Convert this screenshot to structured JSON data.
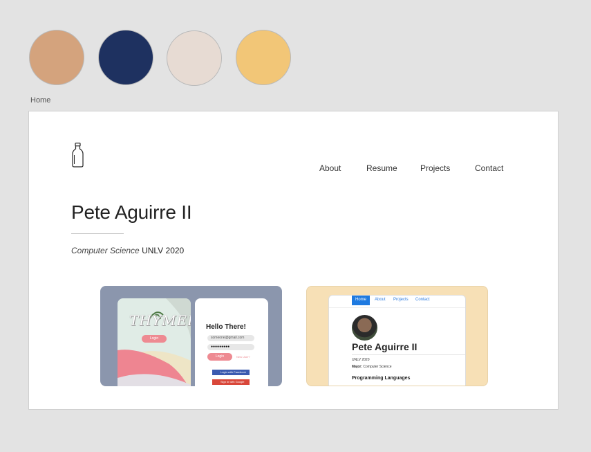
{
  "palette": {
    "colors": [
      "#d4a37d",
      "#1e3160",
      "#e7dbd3",
      "#f2c677"
    ]
  },
  "artboard": {
    "label": "Home"
  },
  "nav": {
    "items": [
      "About",
      "Resume",
      "Projects",
      "Contact"
    ]
  },
  "hero": {
    "name": "Pete Aguirre II",
    "major": "Computer Science",
    "school": "UNLV 2020"
  },
  "projects": {
    "themely": {
      "logo_text": "THYMELY",
      "login_label": "Login",
      "hello": "Hello There!",
      "email_placeholder": "someone@gmail.com",
      "password_dots": "●●●●●●●●●",
      "login_button": "Login",
      "new_user": "New User?",
      "facebook": "Login with Facebook",
      "google": "Sign in with Google"
    },
    "portfolio": {
      "nav": [
        "Home",
        "About",
        "Projects",
        "Contact"
      ],
      "name": "Pete Aguirre II",
      "school": "UNLV 2020",
      "major_label": "Major:",
      "major_value": "Computer Science",
      "section": "Programming Languages"
    }
  }
}
